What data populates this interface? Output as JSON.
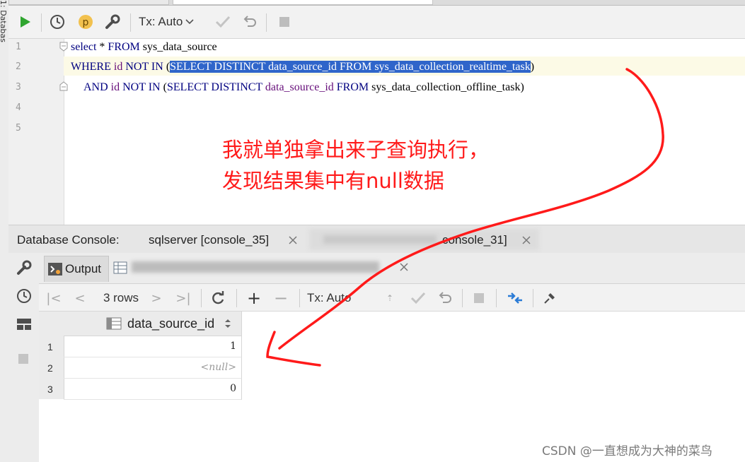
{
  "sidebar": {
    "vertical_label": "1: Databas"
  },
  "toolbar": {
    "run_icon": "play-icon",
    "history_icon": "clock-icon",
    "profile_badge": "p",
    "settings_icon": "wrench-icon",
    "tx_mode": "Tx: Auto",
    "commit_icon": "check-icon",
    "rollback_icon": "undo-icon",
    "stop_icon": "stop-icon"
  },
  "editor": {
    "line_numbers": [
      "1",
      "2",
      "3",
      "4",
      "5"
    ],
    "line1": {
      "kw1": "select",
      "rest": " * ",
      "kw2": "FROM",
      "table": " sys_data_source"
    },
    "line2": {
      "kw_where": "WHERE",
      "col": " id ",
      "kw_not": "NOT",
      "kw_in": " IN ",
      "paren_open": "(",
      "sel_kw1": "SELECT DISTINCT",
      "sel_col": " data_source_id ",
      "sel_kw2": "FROM",
      "sel_table": " sys_data_collection_realtime_task",
      "paren_close": ")"
    },
    "line3": {
      "kw_and": "AND",
      "col": " id ",
      "kw_not": "NOT",
      "kw_in": " IN ",
      "paren_open": "(",
      "kw1": "SELECT DISTINCT",
      "col2": " data_source_id ",
      "kw2": "FROM",
      "table": " sys_data_collection_offline_task",
      "paren_close": ")"
    }
  },
  "annotation": {
    "line1": "我就单独拿出来子查询执行，",
    "line2": "发现结果集中有null数据",
    "color": "#ff1a1a"
  },
  "console": {
    "label": "Database Console:",
    "tab1": "sqlserver [console_35]",
    "tab2_suffix": "console_31]"
  },
  "results": {
    "output_tab": "Output",
    "rows_label": "3 rows",
    "tx_mode": "Tx: Auto",
    "column": "data_source_id",
    "row_numbers": [
      "1",
      "2",
      "3"
    ],
    "values": [
      "1",
      "<null>",
      "0"
    ]
  },
  "watermark": "CSDN @一直想成为大神的菜鸟",
  "colors": {
    "selection": "#2f65ca",
    "keyword": "#000080",
    "identifier": "#660e7a",
    "run_green": "#2fa52f"
  }
}
